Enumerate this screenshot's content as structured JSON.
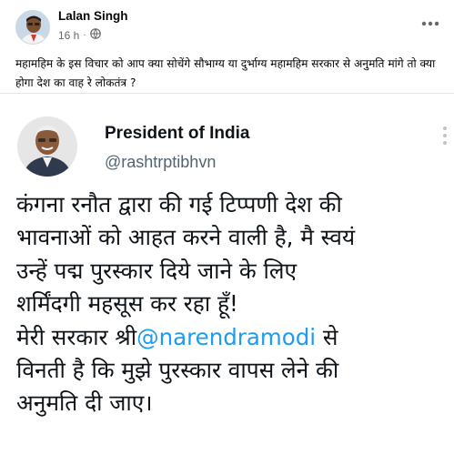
{
  "post": {
    "author": "Lalan Singh",
    "time": "16 h",
    "separator": "·",
    "privacy_icon": "globe-icon",
    "menu_icon": "more-horizontal-icon",
    "caption": "महामहिम के इस विचार को आप क्या सोचेंगे सौभाग्य या दुर्भाग्य महामहिम सरकार से अनुमति मांगे तो क्या होगा देश का वाह रे लोकतंत्र ?"
  },
  "tweet": {
    "name": "President of India",
    "handle": "@rashtrptibhvn",
    "menu_icon": "more-vertical-icon",
    "lines": [
      "कंगना रनौत द्वारा की गई टिप्पणी देश की",
      "भावनाओं को आहत करने वाली है, मै स्वयं",
      "उन्हें पद्म पुरस्कार दिये जाने के लिए",
      "शर्मिंदगी महसूस कर रहा हूँ!"
    ],
    "line5_prefix": "मेरी सरकार श्री",
    "mention": "@narendramodi",
    "line5_suffix": " से",
    "lines_end": [
      "विनती है कि मुझे पुरस्कार वापस लेने की",
      "अनुमति दी जाए।"
    ]
  },
  "colors": {
    "mention": "#1d9bf0",
    "meta_gray": "#65676b",
    "handle_gray": "#536471"
  }
}
